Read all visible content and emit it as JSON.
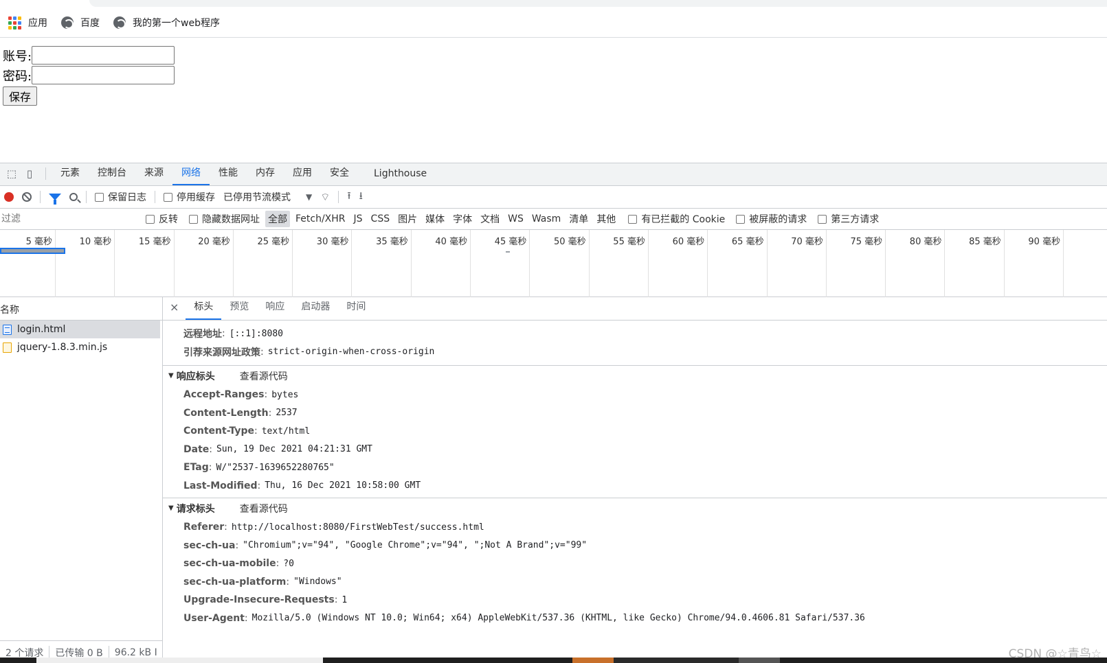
{
  "bookmarks": {
    "apps_label": "应用",
    "items": [
      {
        "label": "百度",
        "icon": "globe-icon"
      },
      {
        "label": "我的第一个web程序",
        "icon": "globe-icon"
      }
    ],
    "apps_colors": [
      "#ea4335",
      "#4285f4",
      "#fbbc05",
      "#34a853",
      "#ea4335",
      "#4285f4",
      "#fbbc05",
      "#34a853",
      "#ea4335"
    ]
  },
  "form": {
    "account_label": "账号:",
    "account_value": "",
    "password_label": "密码:",
    "password_value": "",
    "save_label": "保存"
  },
  "devtools": {
    "tabs": [
      "元素",
      "控制台",
      "来源",
      "网络",
      "性能",
      "内存",
      "应用",
      "安全",
      "Lighthouse"
    ],
    "active_tab": "网络",
    "toolbar": {
      "preserve_log": "保留日志",
      "disable_cache": "停用缓存",
      "throttle": "已停用节流模式"
    },
    "filter": {
      "placeholder": "过滤",
      "invert": "反转",
      "hide_data_urls": "隐藏数据网址",
      "types": [
        "全部",
        "Fetch/XHR",
        "JS",
        "CSS",
        "图片",
        "媒体",
        "字体",
        "文档",
        "WS",
        "Wasm",
        "清单",
        "其他"
      ],
      "active_type": "全部",
      "blocked_cookies": "有已拦截的 Cookie",
      "blocked_requests": "被屏蔽的请求",
      "third_party": "第三方请求"
    },
    "overview_ticks": [
      "5 毫秒",
      "10 毫秒",
      "15 毫秒",
      "20 毫秒",
      "25 毫秒",
      "30 毫秒",
      "35 毫秒",
      "40 毫秒",
      "45 毫秒",
      "50 毫秒",
      "55 毫秒",
      "60 毫秒",
      "65 毫秒",
      "70 毫秒",
      "75 毫秒",
      "80 毫秒",
      "85 毫秒",
      "90 毫秒"
    ],
    "request_list": {
      "header": "名称",
      "requests": [
        {
          "name": "login.html",
          "type": "html",
          "selected": true
        },
        {
          "name": "jquery-1.8.3.min.js",
          "type": "js",
          "selected": false
        }
      ],
      "status": [
        "2 个请求",
        "已传输 0 B",
        "96.2 kB I"
      ]
    },
    "detail": {
      "close": "×",
      "tabs": [
        "标头",
        "预览",
        "响应",
        "启动器",
        "时间"
      ],
      "active_tab": "标头",
      "general": [
        {
          "k": "远程地址",
          "v": "[::1]:8080"
        },
        {
          "k": "引荐来源网址政策",
          "v": "strict-origin-when-cross-origin"
        }
      ],
      "response_headers_title": "响应标头",
      "view_source": "查看源代码",
      "response_headers": [
        {
          "k": "Accept-Ranges",
          "v": "bytes"
        },
        {
          "k": "Content-Length",
          "v": "2537"
        },
        {
          "k": "Content-Type",
          "v": "text/html"
        },
        {
          "k": "Date",
          "v": "Sun, 19 Dec 2021 04:21:31 GMT"
        },
        {
          "k": "ETag",
          "v": "W/\"2537-1639652280765\""
        },
        {
          "k": "Last-Modified",
          "v": "Thu, 16 Dec 2021 10:58:00 GMT"
        }
      ],
      "request_headers_title": "请求标头",
      "request_headers": [
        {
          "k": "Referer",
          "v": "http://localhost:8080/FirstWebTest/success.html"
        },
        {
          "k": "sec-ch-ua",
          "v": "\"Chromium\";v=\"94\", \"Google Chrome\";v=\"94\", \";Not A Brand\";v=\"99\""
        },
        {
          "k": "sec-ch-ua-mobile",
          "v": "?0"
        },
        {
          "k": "sec-ch-ua-platform",
          "v": "\"Windows\""
        },
        {
          "k": "Upgrade-Insecure-Requests",
          "v": "1"
        },
        {
          "k": "User-Agent",
          "v": "Mozilla/5.0 (Windows NT 10.0; Win64; x64) AppleWebKit/537.36 (KHTML, like Gecko) Chrome/94.0.4606.81 Safari/537.36"
        }
      ]
    }
  },
  "watermark": "CSDN @☆青鸟☆",
  "colors": {
    "accent": "#1a73e8",
    "record": "#d93025"
  }
}
